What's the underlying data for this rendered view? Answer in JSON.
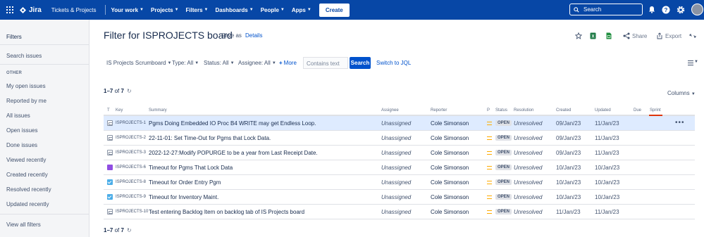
{
  "topnav": {
    "app_name": "Jira",
    "items": [
      {
        "label": "Tickets & Projects",
        "dropdown": false
      },
      {
        "label": "Your work",
        "dropdown": true
      },
      {
        "label": "Projects",
        "dropdown": true
      },
      {
        "label": "Filters",
        "dropdown": true
      },
      {
        "label": "Dashboards",
        "dropdown": true
      },
      {
        "label": "People",
        "dropdown": true
      },
      {
        "label": "Apps",
        "dropdown": true
      }
    ],
    "create_label": "Create",
    "search_placeholder": "Search",
    "icons": [
      "notifications-icon",
      "help-icon",
      "settings-icon",
      "avatar"
    ]
  },
  "sidebar": {
    "title": "Filters",
    "search_issues": "Search issues",
    "other_header": "OTHER",
    "links": [
      "My open issues",
      "Reported by me",
      "All issues",
      "Open issues",
      "Done issues",
      "Viewed recently",
      "Created recently",
      "Resolved recently",
      "Updated recently"
    ],
    "view_all": "View all filters"
  },
  "header": {
    "title": "Filter for ISPROJECTS board",
    "save_as": "Save as",
    "details": "Details",
    "share": "Share",
    "export": "Export"
  },
  "filters": {
    "project": "IS Projects Scrumboard",
    "type": "Type: All",
    "status": "Status: All",
    "assignee": "Assignee: All",
    "more": "More",
    "contains_placeholder": "Contains text",
    "search_button": "Search",
    "switch_jql": "Switch to JQL"
  },
  "results": {
    "range": "1–7",
    "of": "of",
    "total": "7",
    "columns_label": "Columns"
  },
  "table": {
    "headers": [
      "T",
      "Key",
      "Summary",
      "Assignee",
      "Reporter",
      "P",
      "Status",
      "Resolution",
      "Created",
      "Updated",
      "Due",
      "Sprint"
    ],
    "rows": [
      {
        "type": "subtask",
        "key": "ISPROJECTS-1",
        "summary": "Pgms Doing Embedded IO Proc B4 WRITE may get Endless Loop.",
        "assignee": "Unassigned",
        "reporter": "Cole Simonson",
        "priority": "medium",
        "status": "OPEN",
        "resolution": "Unresolved",
        "created": "09/Jan/23",
        "updated": "11/Jan/23",
        "selected": true
      },
      {
        "type": "subtask",
        "key": "ISPROJECTS-2",
        "summary": "22-11-01: Set Time-Out for Pgms that Lock Data.",
        "assignee": "Unassigned",
        "reporter": "Cole Simonson",
        "priority": "medium",
        "status": "OPEN",
        "resolution": "Unresolved",
        "created": "09/Jan/23",
        "updated": "11/Jan/23"
      },
      {
        "type": "subtask",
        "key": "ISPROJECTS-3",
        "summary": "2022-12-27:Modify POPURGE to be a year from Last Receipt Date.",
        "assignee": "Unassigned",
        "reporter": "Cole Simonson",
        "priority": "medium",
        "status": "OPEN",
        "resolution": "Unresolved",
        "created": "09/Jan/23",
        "updated": "11/Jan/23"
      },
      {
        "type": "epic",
        "key": "ISPROJECTS-6",
        "summary": "Timeout for Pgms That Lock Data",
        "assignee": "Unassigned",
        "reporter": "Cole Simonson",
        "priority": "medium",
        "status": "OPEN",
        "resolution": "Unresolved",
        "created": "10/Jan/23",
        "updated": "10/Jan/23"
      },
      {
        "type": "task",
        "key": "ISPROJECTS-8",
        "summary": "Timeout for Order Entry Pgm",
        "assignee": "Unassigned",
        "reporter": "Cole Simonson",
        "priority": "medium",
        "status": "OPEN",
        "resolution": "Unresolved",
        "created": "10/Jan/23",
        "updated": "10/Jan/23"
      },
      {
        "type": "task",
        "key": "ISPROJECTS-9",
        "summary": "Timeout for Inventory Maint.",
        "assignee": "Unassigned",
        "reporter": "Cole Simonson",
        "priority": "medium",
        "status": "OPEN",
        "resolution": "Unresolved",
        "created": "10/Jan/23",
        "updated": "10/Jan/23"
      },
      {
        "type": "subtask",
        "key": "ISPROJECTS-10",
        "summary": "Test entering Backlog Item on backlog tab of IS Projects board",
        "assignee": "Unassigned",
        "reporter": "Cole Simonson",
        "priority": "medium",
        "status": "OPEN",
        "resolution": "Unresolved",
        "created": "11/Jan/23",
        "updated": "11/Jan/23"
      }
    ]
  },
  "colors": {
    "nav_bg": "#0747a6",
    "link": "#0052cc",
    "selected_row": "#deebff",
    "priority_medium": "#ffab00",
    "task": "#4bade8",
    "epic": "#904ee2"
  }
}
